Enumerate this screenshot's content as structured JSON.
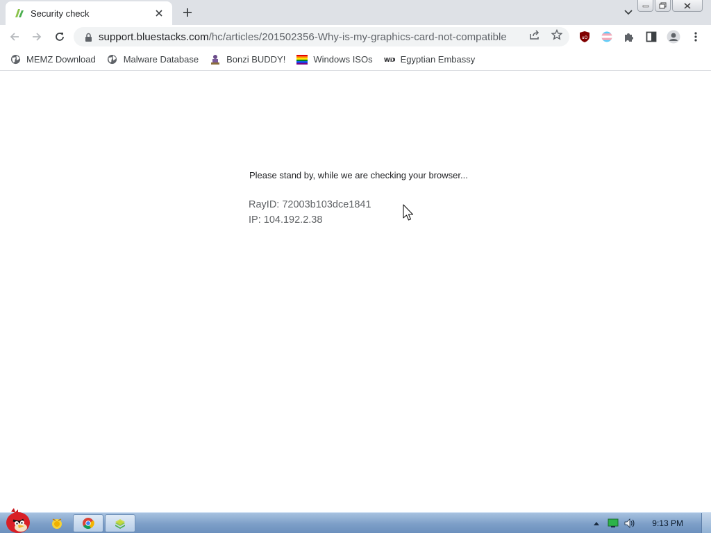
{
  "tab": {
    "title": "Security check",
    "favicon": "bluestacks-favicon-icon"
  },
  "toolbar": {
    "url_host": "support.bluestacks.com",
    "url_path": "/hc/articles/201502356-Why-is-my-graphics-card-not-compatible"
  },
  "bookmarks": [
    {
      "label": "MEMZ Download",
      "icon": "globe-icon"
    },
    {
      "label": "Malware Database",
      "icon": "globe-icon"
    },
    {
      "label": "Bonzi BUDDY!",
      "icon": "bonzi-icon"
    },
    {
      "label": "Windows ISOs",
      "icon": "rainbow-flag-icon"
    },
    {
      "label": "Egyptian Embassy",
      "icon": "wix-icon"
    }
  ],
  "page": {
    "standby": "Please stand by, while we are checking your browser...",
    "rayid": "RayID: 72003b103dce1841",
    "ip": "IP: 104.192.2.38"
  },
  "taskbar": {
    "clock": "9:13 PM"
  },
  "colors": {
    "tabstrip": "#dee1e6",
    "omnibox": "#f1f3f4",
    "taskbar": "#7d9fc8"
  }
}
